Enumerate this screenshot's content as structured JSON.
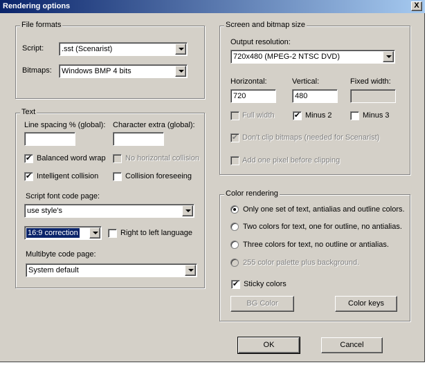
{
  "window": {
    "title": "Rendering options",
    "close_glyph": "X"
  },
  "file_formats": {
    "legend": "File formats",
    "script_label": "Script:",
    "script_value": ".sst (Scenarist)",
    "bitmaps_label": "Bitmaps:",
    "bitmaps_value": "Windows BMP 4 bits"
  },
  "text": {
    "legend": "Text",
    "line_spacing_label": "Line spacing % (global):",
    "line_spacing_value": "",
    "char_extra_label": "Character extra (global):",
    "char_extra_value": "",
    "balanced_wrap": {
      "label": "Balanced word wrap",
      "checked": true
    },
    "no_horizontal_collision": {
      "label": "No horizontal collision",
      "checked": false,
      "disabled": true
    },
    "intelligent_collision": {
      "label": "Intelligent collision",
      "checked": true
    },
    "collision_foreseeing": {
      "label": "Collision foreseeing",
      "checked": false
    },
    "script_font_cp_label": "Script font code page:",
    "script_font_cp_value": "use style's",
    "aspect_value": "16:9 correction",
    "rtl": {
      "label": "Right to left language",
      "checked": false
    },
    "multibyte_label": "Multibyte code page:",
    "multibyte_value": "System default"
  },
  "screen": {
    "legend": "Screen and bitmap size",
    "output_res_label": "Output resolution:",
    "output_res_value": "720x480 (MPEG-2 NTSC DVD)",
    "horizontal_label": "Horizontal:",
    "horizontal_value": "720",
    "vertical_label": "Vertical:",
    "vertical_value": "480",
    "fixed_width_label": "Fixed width:",
    "fixed_width_value": "",
    "full_width": {
      "label": "Full width",
      "checked": false,
      "disabled": true
    },
    "minus2": {
      "label": "Minus 2",
      "checked": true
    },
    "minus3": {
      "label": "Minus 3",
      "checked": false
    },
    "dont_clip": {
      "label": "Don't clip bitmaps (needed for Scenarist)",
      "checked": true,
      "disabled": true
    },
    "add_pixel": {
      "label": "Add one pixel before clipping",
      "checked": false,
      "disabled": true
    }
  },
  "color": {
    "legend": "Color rendering",
    "options": [
      {
        "label": "Only one set of text, antialias and outline colors.",
        "selected": true,
        "disabled": false
      },
      {
        "label": "Two colors for text, one for outline, no antialias.",
        "selected": false,
        "disabled": false
      },
      {
        "label": "Three colors for text, no outline or antialias.",
        "selected": false,
        "disabled": false
      },
      {
        "label": "255 color palette plus background.",
        "selected": false,
        "disabled": true
      }
    ],
    "sticky": {
      "label": "Sticky colors",
      "checked": true
    },
    "bg_color_button": "BG Color",
    "color_keys_button": "Color keys"
  },
  "buttons": {
    "ok": "OK",
    "cancel": "Cancel"
  },
  "check_glyph": "✔"
}
